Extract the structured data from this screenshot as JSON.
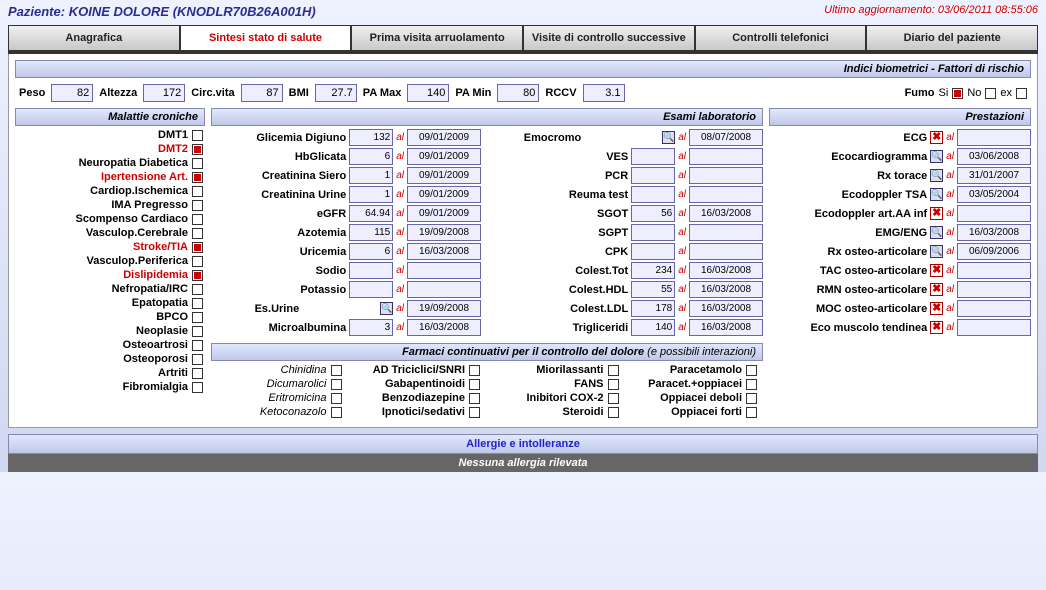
{
  "header": {
    "patient_label": "Paziente:",
    "patient_name": "KOINE DOLORE (KNODLR70B26A001H)",
    "update_label": "Ultimo aggiornamento:",
    "update_value": "03/06/2011 08:55:06"
  },
  "tabs": [
    {
      "label": "Anagrafica",
      "active": false
    },
    {
      "label": "Sintesi stato di salute",
      "active": true
    },
    {
      "label": "Prima visita arruolamento",
      "active": false
    },
    {
      "label": "Visite di controllo successive",
      "active": false
    },
    {
      "label": "Controlli telefonici",
      "active": false
    },
    {
      "label": "Diario del paziente",
      "active": false
    }
  ],
  "bio": {
    "title": "Indici biometrici - Fattori di rischio",
    "peso_lbl": "Peso",
    "peso": "82",
    "alt_lbl": "Altezza",
    "alt": "172",
    "circ_lbl": "Circ.vita",
    "circ": "87",
    "bmi_lbl": "BMI",
    "bmi": "27.7",
    "pamax_lbl": "PA Max",
    "pamax": "140",
    "pamin_lbl": "PA Min",
    "pamin": "80",
    "rccv_lbl": "RCCV",
    "rccv": "3.1",
    "fumo_lbl": "Fumo",
    "fumo_si": "Si",
    "fumo_no": "No",
    "fumo_ex": "ex",
    "fumo_val": "Si"
  },
  "chronic": {
    "title": "Malattie croniche",
    "items": [
      {
        "label": "DMT1",
        "checked": false
      },
      {
        "label": "DMT2",
        "checked": true
      },
      {
        "label": "Neuropatia Diabetica",
        "checked": false
      },
      {
        "label": "Ipertensione Art.",
        "checked": true
      },
      {
        "label": "Cardiop.Ischemica",
        "checked": false
      },
      {
        "label": "IMA Pregresso",
        "checked": false
      },
      {
        "label": "Scompenso Cardiaco",
        "checked": false
      },
      {
        "label": "Vasculop.Cerebrale",
        "checked": false
      },
      {
        "label": "Stroke/TIA",
        "checked": true
      },
      {
        "label": "Vasculop.Periferica",
        "checked": false
      },
      {
        "label": "Dislipidemia",
        "checked": true
      },
      {
        "label": "Nefropatia/IRC",
        "checked": false
      },
      {
        "label": "Epatopatia",
        "checked": false
      },
      {
        "label": "BPCO",
        "checked": false
      },
      {
        "label": "Neoplasie",
        "checked": false
      },
      {
        "label": "Osteoartrosi",
        "checked": false
      },
      {
        "label": "Osteoporosi",
        "checked": false
      },
      {
        "label": "Artriti",
        "checked": false
      },
      {
        "label": "Fibromialgia",
        "checked": false
      }
    ]
  },
  "lab": {
    "title": "Esami laboratorio",
    "al": "al",
    "left": [
      {
        "name": "Glicemia Digiuno",
        "val": "132",
        "date": "09/01/2009",
        "doc": false
      },
      {
        "name": "HbGlicata",
        "val": "6",
        "date": "09/01/2009",
        "doc": false
      },
      {
        "name": "Creatinina Siero",
        "val": "1",
        "date": "09/01/2009",
        "doc": false
      },
      {
        "name": "Creatinina Urine",
        "val": "1",
        "date": "09/01/2009",
        "doc": false
      },
      {
        "name": "eGFR",
        "val": "64.94",
        "date": "09/01/2009",
        "doc": false
      },
      {
        "name": "Azotemia",
        "val": "115",
        "date": "19/09/2008",
        "doc": false
      },
      {
        "name": "Uricemia",
        "val": "6",
        "date": "16/03/2008",
        "doc": false
      },
      {
        "name": "Sodio",
        "val": "",
        "date": "",
        "doc": false
      },
      {
        "name": "Potassio",
        "val": "",
        "date": "",
        "doc": false
      },
      {
        "name": "Es.Urine",
        "val": "",
        "date": "19/09/2008",
        "doc": true
      },
      {
        "name": "Microalbumina",
        "val": "3",
        "date": "16/03/2008",
        "doc": false
      }
    ],
    "right": [
      {
        "name": "Emocromo",
        "val": "",
        "date": "08/07/2008",
        "doc": true
      },
      {
        "name": "VES",
        "val": "",
        "date": "",
        "doc": false
      },
      {
        "name": "PCR",
        "val": "",
        "date": "",
        "doc": false
      },
      {
        "name": "Reuma test",
        "val": "",
        "date": "",
        "doc": false
      },
      {
        "name": "SGOT",
        "val": "56",
        "date": "16/03/2008",
        "doc": false
      },
      {
        "name": "SGPT",
        "val": "",
        "date": "",
        "doc": false
      },
      {
        "name": "CPK",
        "val": "",
        "date": "",
        "doc": false
      },
      {
        "name": "Colest.Tot",
        "val": "234",
        "date": "16/03/2008",
        "doc": false
      },
      {
        "name": "Colest.HDL",
        "val": "55",
        "date": "16/03/2008",
        "doc": false
      },
      {
        "name": "Colest.LDL",
        "val": "178",
        "date": "16/03/2008",
        "doc": false
      },
      {
        "name": "Trigliceridi",
        "val": "140",
        "date": "16/03/2008",
        "doc": false
      }
    ]
  },
  "prest": {
    "title": "Prestazioni",
    "al": "al",
    "items": [
      {
        "name": "ECG",
        "icon": "x",
        "date": ""
      },
      {
        "name": "Ecocardiogramma",
        "icon": "p",
        "date": "03/06/2008"
      },
      {
        "name": "Rx torace",
        "icon": "p",
        "date": "31/01/2007"
      },
      {
        "name": "Ecodoppler TSA",
        "icon": "p",
        "date": "03/05/2004"
      },
      {
        "name": "Ecodoppler art.AA inf",
        "icon": "x",
        "date": ""
      },
      {
        "name": "EMG/ENG",
        "icon": "p",
        "date": "16/03/2008"
      },
      {
        "name": "Rx osteo-articolare",
        "icon": "p",
        "date": "06/09/2006"
      },
      {
        "name": "TAC osteo-articolare",
        "icon": "x",
        "date": ""
      },
      {
        "name": "RMN osteo-articolare",
        "icon": "x",
        "date": ""
      },
      {
        "name": "MOC osteo-articolare",
        "icon": "x",
        "date": ""
      },
      {
        "name": "Eco muscolo tendinea",
        "icon": "x",
        "date": ""
      }
    ]
  },
  "farm": {
    "title": "Farmaci continuativi per il controllo del dolore",
    "sub": "(e possibili interazioni)",
    "c1": [
      "Chinidina",
      "Dicumarolici",
      "Eritromicina",
      "Ketoconazolo"
    ],
    "c2": [
      "AD Triciclici/SNRI",
      "Gabapentinoidi",
      "Benzodiazepine",
      "Ipnotici/sedativi"
    ],
    "c3": [
      "Miorilassanti",
      "FANS",
      "Inibitori COX-2",
      "Steroidi"
    ],
    "c4": [
      "Paracetamolo",
      "Paracet.+oppiacei",
      "Oppiacei deboli",
      "Oppiacei forti"
    ]
  },
  "allergy": {
    "title": "Allergie e intolleranze",
    "body": "Nessuna allergia rilevata"
  }
}
